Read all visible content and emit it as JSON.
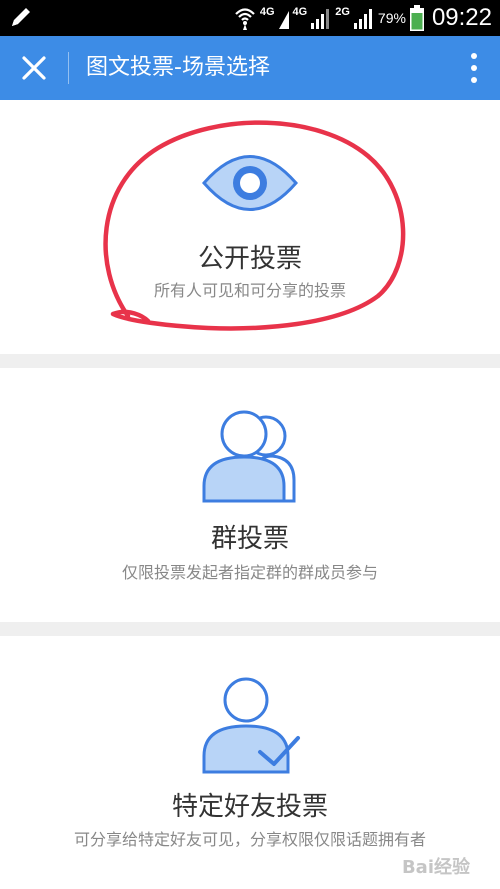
{
  "status_bar": {
    "network_labels": [
      "4G",
      "4G",
      "2G"
    ],
    "battery_percent": "79%",
    "time": "09:22"
  },
  "app_bar": {
    "title": "图文投票-场景选择"
  },
  "options": [
    {
      "title": "公开投票",
      "description": "所有人可见和可分享的投票",
      "icon": "eye-icon"
    },
    {
      "title": "群投票",
      "description": "仅限投票发起者指定群的群成员参与",
      "icon": "group-icon"
    },
    {
      "title": "特定好友投票",
      "description": "可分享给特定好友可见，分享权限仅限话题拥有者",
      "icon": "person-check-icon"
    }
  ],
  "colors": {
    "app_bar": "#3d8ce6",
    "icon_stroke": "#3d7de0",
    "icon_fill": "#b8d4f7",
    "annotation": "#e8334a"
  },
  "watermark": "Bai经验"
}
